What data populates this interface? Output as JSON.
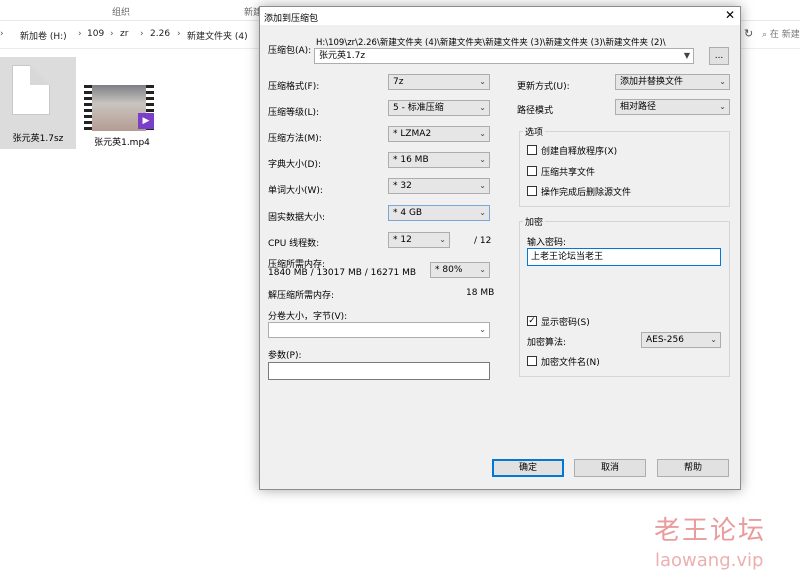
{
  "explorer": {
    "ribbon_group": "组织",
    "ribbon_new": "新建",
    "breadcrumb": [
      "新加卷 (H:)",
      "109",
      "zr",
      "2.26",
      "新建文件夹 (4)"
    ],
    "search_placeholder": "在 新建",
    "files": [
      {
        "name": "张元英1.7sz",
        "type": "document"
      },
      {
        "name": "张元英1.mp4",
        "type": "video"
      }
    ]
  },
  "dialog": {
    "title": "添加到压缩包",
    "archive_label": "压缩包(A):",
    "archive_path": "H:\\109\\zr\\2.26\\新建文件夹 (4)\\新建文件夹\\新建文件夹 (3)\\新建文件夹 (3)\\新建文件夹 (2)\\",
    "archive_name": "张元英1.7z",
    "browse_label": "...",
    "format_label": "压缩格式(F):",
    "format_value": "7z",
    "level_label": "压缩等级(L):",
    "level_value": "5 - 标准压缩",
    "method_label": "压缩方法(M):",
    "method_value": "* LZMA2",
    "dict_label": "字典大小(D):",
    "dict_value": "* 16 MB",
    "word_label": "单词大小(W):",
    "word_value": "* 32",
    "solid_label": "固实数据大小:",
    "solid_value": "* 4 GB",
    "cpu_label": "CPU 线程数:",
    "cpu_value": "* 12",
    "cpu_total": "/ 12",
    "mem_comp_label": "压缩所需内存:",
    "mem_comp_value": "1840 MB / 13017 MB / 16271 MB",
    "mem_pct_value": "* 80%",
    "mem_decomp_label": "解压缩所需内存:",
    "mem_decomp_value": "18 MB",
    "split_label": "分卷大小，字节(V):",
    "split_value": "",
    "params_label": "参数(P):",
    "params_value": "",
    "update_label": "更新方式(U):",
    "update_value": "添加并替换文件",
    "path_mode_label": "路径模式",
    "path_mode_value": "相对路径",
    "options_title": "选项",
    "opt_sfx": "创建自释放程序(X)",
    "opt_shared": "压缩共享文件",
    "opt_delete": "操作完成后删除源文件",
    "enc_title": "加密",
    "enc_pwd_label": "输入密码:",
    "enc_pwd_value": "上老王论坛当老王",
    "show_pwd_label": "显示密码(S)",
    "show_pwd_checked": true,
    "enc_method_label": "加密算法:",
    "enc_method_value": "AES-256",
    "enc_names_label": "加密文件名(N)",
    "ok_label": "确定",
    "cancel_label": "取消",
    "help_label": "帮助"
  },
  "watermark": {
    "line1": "老王论坛",
    "line2": "laowang.vip"
  }
}
